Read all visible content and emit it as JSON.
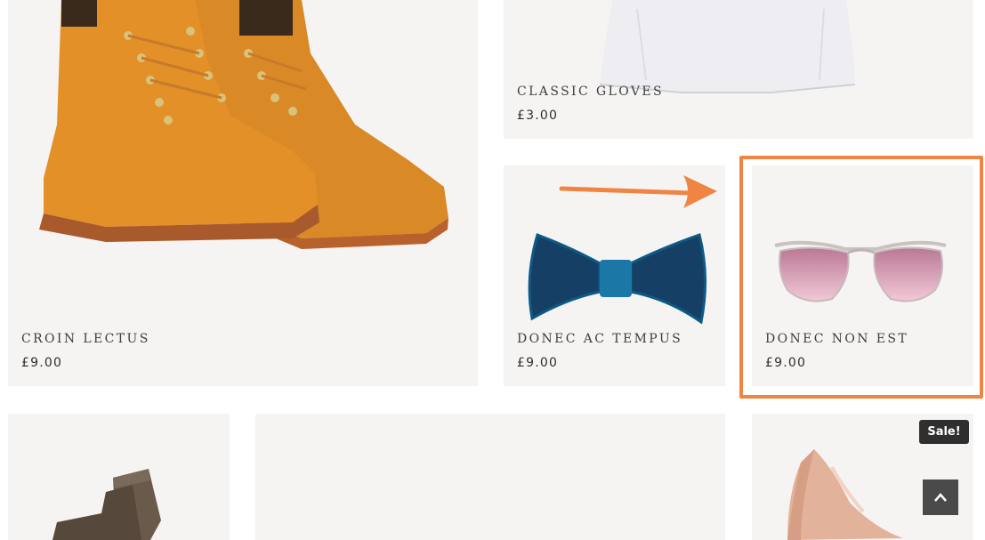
{
  "products": [
    {
      "name": "CROIN LECTUS",
      "price": "£9.00",
      "image": "orange-boot-image"
    },
    {
      "name": "CLASSIC GLOVES",
      "price": "£3.00",
      "image": "white-tshirt-image"
    },
    {
      "name": "DONEC AC TEMPUS",
      "price": "£9.00",
      "image": "blue-bow-tie-image"
    },
    {
      "name": "DONEC NON EST",
      "price": "£9.00",
      "image": "pink-sunglasses-image"
    },
    {
      "image": "wool-socks-image"
    },
    {
      "image": "blank-product-image"
    },
    {
      "image": "nude-heel-shoe-image",
      "badge": "Sale!"
    }
  ],
  "back_to_top": {
    "icon": "chevron-up-icon"
  },
  "annotation": {
    "arrow_color": "#f08443",
    "highlight_color": "#f08443"
  }
}
